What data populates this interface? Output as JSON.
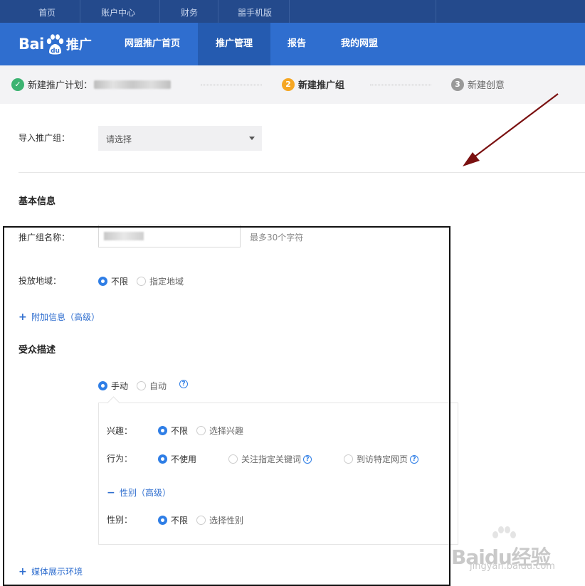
{
  "topbar": {
    "items": [
      "首页",
      "账户中心",
      "财务",
      "噐手机版"
    ]
  },
  "logo": {
    "bai": "Bai",
    "du": "du",
    "suffix": "推广"
  },
  "nav": {
    "items": [
      "网盟推广首页",
      "推广管理",
      "报告",
      "我的网盟"
    ],
    "active": "推广管理"
  },
  "steps": {
    "step1": {
      "label": "新建推广计划：",
      "num": "✓"
    },
    "step2": {
      "label": "新建推广组",
      "num": "2"
    },
    "step3": {
      "label": "新建创意",
      "num": "3"
    }
  },
  "form": {
    "import_label": "导入推广组：",
    "import_value": "请选择",
    "basic_section": "基本信息",
    "name_label": "推广组名称：",
    "name_hint": "最多30个字符",
    "region_label": "投放地域：",
    "region_opt1": "不限",
    "region_opt2": "指定地域",
    "extra_link": "附加信息（高级）",
    "audience_section": "受众描述",
    "mode_opt1": "手动",
    "mode_opt2": "自动",
    "interest_label": "兴趣：",
    "interest_opt1": "不限",
    "interest_opt2": "选择兴趣",
    "behavior_label": "行为：",
    "behavior_opt1": "不使用",
    "behavior_opt2": "关注指定关键词",
    "behavior_opt3": "到访特定网页",
    "gender_link": "性别（高级）",
    "gender_label": "性别：",
    "gender_opt1": "不限",
    "gender_opt2": "选择性别",
    "media_link": "媒体展示环境"
  },
  "icons": {
    "help": "?",
    "plus": "+",
    "minus": "−"
  },
  "watermark": {
    "brand": "Baidu经验",
    "url": "jingyan.baidu.com"
  },
  "colors": {
    "nav_bg": "#2f6ecf",
    "top_bg": "#244a8c",
    "accent": "#2f7ee6",
    "step_done": "#3cb371",
    "step_current": "#f5a623"
  }
}
